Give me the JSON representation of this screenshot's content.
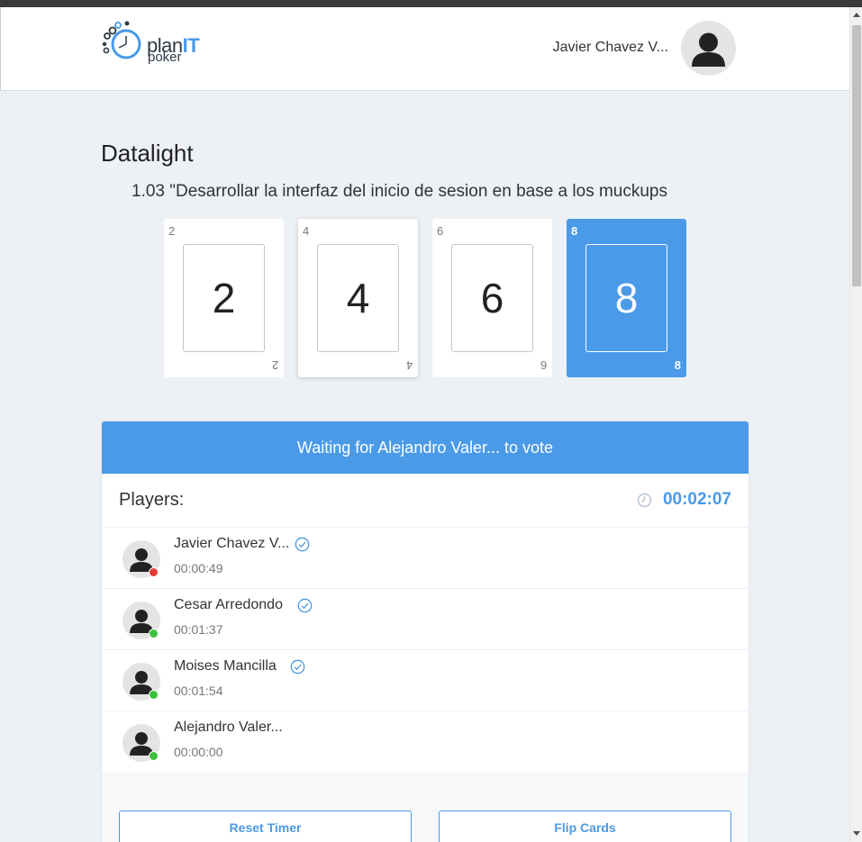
{
  "header": {
    "logo_text_plan": "plan",
    "logo_text_it": "IT",
    "logo_text_poker": "poker",
    "username": "Javier Chavez V...",
    "icons": [
      "clock-logo-icon",
      "user-avatar-icon"
    ]
  },
  "room": {
    "title": "Datalight",
    "story": "1.03 \"Desarrollar la interfaz del inicio de sesion en base a los muckups"
  },
  "cards": [
    {
      "value": "2",
      "selected": false
    },
    {
      "value": "4",
      "selected": false
    },
    {
      "value": "6",
      "selected": false
    },
    {
      "value": "8",
      "selected": true
    }
  ],
  "panel": {
    "banner": "Waiting for Alejandro Valer... to vote",
    "players_label": "Players:",
    "timer": "00:02:07",
    "players": [
      {
        "name": "Javier Chavez V...",
        "time": "00:00:49",
        "voted": true,
        "status": "offline"
      },
      {
        "name": "Cesar Arredondo",
        "time": "00:01:37",
        "voted": true,
        "status": "online"
      },
      {
        "name": "Moises Mancilla",
        "time": "00:01:54",
        "voted": true,
        "status": "online"
      },
      {
        "name": "Alejandro Valer...",
        "time": "00:00:00",
        "voted": false,
        "status": "online"
      }
    ],
    "reset_timer_label": "Reset Timer",
    "flip_cards_label": "Flip Cards"
  },
  "colors": {
    "accent": "#4a9ae8",
    "status_online": "#3cc13b",
    "status_offline": "#e53935",
    "page_bg": "#edf1f5"
  }
}
